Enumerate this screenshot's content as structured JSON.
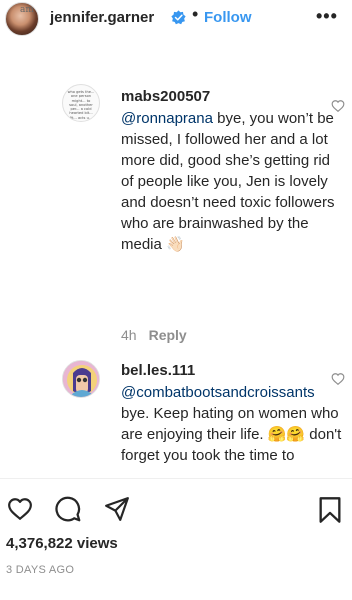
{
  "header": {
    "avatar_watermark": "am",
    "username": "jennifer.garner",
    "separator": "•",
    "follow_label": "Follow",
    "more_label": "•••"
  },
  "comments": [
    {
      "username": "mabs200507",
      "mention": "@ronnaprana",
      "text": " bye, you won’t be missed, I followed her and a lot more did, good she’s getting rid of people like you, Jen is lovely and doesn’t need toxic followers who are brainwashed by the media",
      "emoji": "👋🏻",
      "time": "4h",
      "reply_label": "Reply",
      "avatar_text": "who gets the... one person might... to soul, another per... a cold hearted bit... fit... acts u..."
    },
    {
      "username": "bel.les.111",
      "mention": "@combatbootsandcroissants",
      "text": " bye. Keep hating on women who are enjoying their life. 🤗🤗 don't forget you took the time to"
    }
  ],
  "stats": {
    "views": "4,376,822 views",
    "posted": "3 DAYS AGO"
  },
  "colors": {
    "accent": "#3897f0",
    "mention": "#003569",
    "muted": "#8e8e8e"
  }
}
